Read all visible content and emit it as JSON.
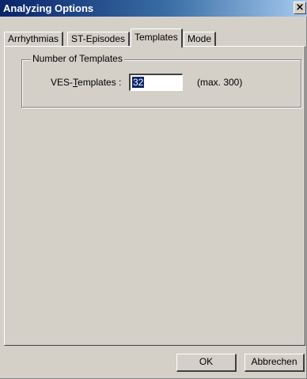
{
  "window": {
    "title": "Analyzing Options",
    "close_glyph": "×"
  },
  "tabs": [
    {
      "label": "Arrhythmias",
      "active": false
    },
    {
      "label": "ST-Episodes",
      "active": false
    },
    {
      "label": "Templates",
      "active": true
    },
    {
      "label": "Mode",
      "active": false
    }
  ],
  "templates_panel": {
    "group_title": "Number of Templates",
    "ves_label_prefix": "VES-",
    "ves_label_mnemonic": "T",
    "ves_label_suffix": "emplates :",
    "ves_value": "32",
    "max_hint": "(max. 300)"
  },
  "buttons": {
    "ok_label": "OK",
    "cancel_label": "Abbrechen"
  },
  "colors": {
    "titlebar_start": "#0a246a",
    "titlebar_end": "#a6caf0",
    "face": "#d4d0c8",
    "selection": "#0a246a"
  }
}
